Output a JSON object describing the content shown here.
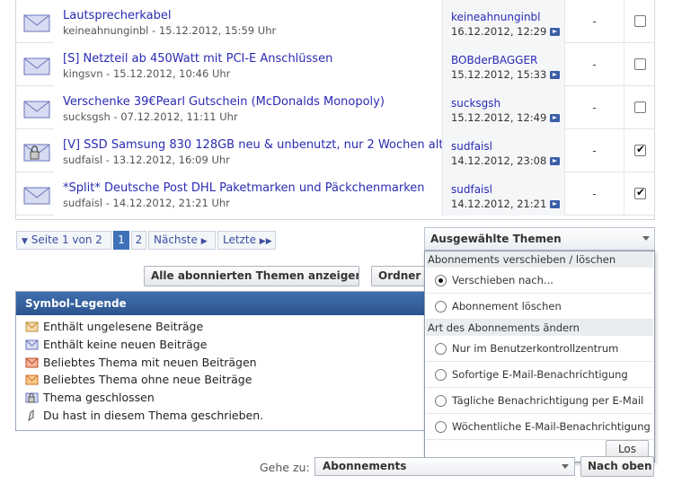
{
  "threads": [
    {
      "title": "Lautsprecherkabel",
      "meta": "keineahnunginbl - 15.12.2012, 15:59 Uhr",
      "last_user": "keineahnunginbl",
      "last_date": "16.12.2012, 12:29",
      "views": "-",
      "checked": false,
      "icon": "thread-no-new-icon"
    },
    {
      "title": "[S] Netzteil ab 450Watt mit PCI-E Anschlüssen",
      "meta": "kingsvn - 15.12.2012, 10:46 Uhr",
      "last_user": "BOBderBAGGER",
      "last_date": "15.12.2012, 15:33",
      "views": "-",
      "checked": false,
      "icon": "thread-no-new-icon"
    },
    {
      "title": "Verschenke 39€Pearl Gutschein (McDonalds Monopoly)",
      "meta": "sucksgsh - 07.12.2012, 11:11 Uhr",
      "last_user": "sucksgsh",
      "last_date": "15.12.2012, 12:49",
      "views": "-",
      "checked": false,
      "icon": "thread-no-new-icon"
    },
    {
      "title": "[V] SSD Samsung 830 128GB neu & unbenutzt, nur 2 Wochen alt",
      "meta": "sudfaisl - 13.12.2012, 16:09 Uhr",
      "last_user": "sudfaisl",
      "last_date": "14.12.2012, 23:08",
      "views": "-",
      "checked": true,
      "icon": "thread-locked-icon"
    },
    {
      "title": "*Split* Deutsche Post DHL Paketmarken und Päckchenmarken",
      "meta": "sudfaisl - 14.12.2012, 21:21 Uhr",
      "last_user": "sudfaisl",
      "last_date": "14.12.2012, 21:21",
      "views": "-",
      "checked": true,
      "icon": "thread-no-new-icon"
    }
  ],
  "pager": {
    "page_info": "Seite 1 von 2",
    "pages": [
      "1",
      "2"
    ],
    "current_page": "1",
    "next": "Nächste",
    "last": "Letzte"
  },
  "buttons": {
    "show_all": "Alle abonnierten Themen anzeigen",
    "order": "Ordner b"
  },
  "legend": {
    "title": "Symbol-Legende",
    "items": [
      {
        "label": "Enthält ungelesene Beiträge",
        "icon": "unread-posts-icon"
      },
      {
        "label": "Enthält keine neuen Beiträge",
        "icon": "no-new-posts-icon"
      },
      {
        "label": "Beliebtes Thema mit neuen Beiträgen",
        "icon": "hot-new-icon"
      },
      {
        "label": "Beliebtes Thema ohne neue Beiträge",
        "icon": "hot-no-new-icon"
      },
      {
        "label": "Thema geschlossen",
        "icon": "locked-icon"
      },
      {
        "label": "Du hast in diesem Thema geschrieben.",
        "icon": "posted-icon"
      }
    ]
  },
  "selected_menu": {
    "title": "Ausgewählte Themen",
    "group1": "Abonnements verschieben / löschen",
    "group1_options": [
      {
        "label": "Verschieben nach...",
        "selected": true
      },
      {
        "label": "Abonnement löschen",
        "selected": false
      }
    ],
    "group2": "Art des Abonnements ändern",
    "group2_options": [
      {
        "label": "Nur im Benutzerkontrollzentrum",
        "selected": false
      },
      {
        "label": "Sofortige E-Mail-Benachrichtigung",
        "selected": false
      },
      {
        "label": "Tägliche Benachrichtigung per E-Mail",
        "selected": false
      },
      {
        "label": "Wöchentliche E-Mail-Benachrichtigung",
        "selected": false
      }
    ],
    "go": "Los"
  },
  "goto": {
    "label": "Gehe zu:",
    "value": "Abonnements",
    "button": "Nach oben"
  },
  "colors": {
    "link": "#2a2bb3",
    "header": "#2c548e",
    "current_page": "#3f71b8"
  }
}
